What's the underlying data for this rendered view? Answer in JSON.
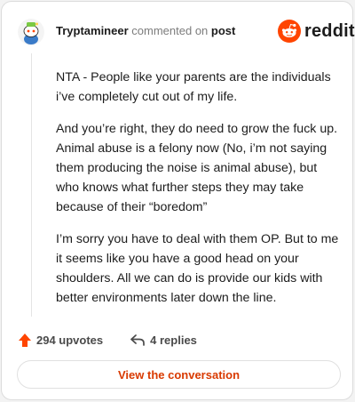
{
  "header": {
    "username": "Tryptamineer",
    "action_text": "commented on",
    "post_link": "post",
    "brand": "reddit"
  },
  "comment": {
    "paragraphs": [
      "NTA - People like your parents are the individuals i’ve completely cut out of my life.",
      "And you’re right, they do need to grow the fuck up. Animal abuse is a felony now (No, i’m not saying them producing the noise is animal abuse), but who knows what further steps they may take because of their “boredom”",
      "I’m sorry you have to deal with them OP. But to me it seems like you have a good head on your shoulders. All we can do is provide our kids with better environments later down the line."
    ]
  },
  "actions": {
    "upvotes_label": "294 upvotes",
    "replies_label": "4 replies"
  },
  "cta": {
    "label": "View the conversation"
  },
  "colors": {
    "brand_orange": "#ff4500",
    "cta_text": "#d93a00"
  },
  "icons": {
    "avatar": "snoo-avatar-icon",
    "brand": "reddit-logo-icon",
    "upvote": "upvote-arrow-icon",
    "reply": "reply-arrow-icon"
  }
}
